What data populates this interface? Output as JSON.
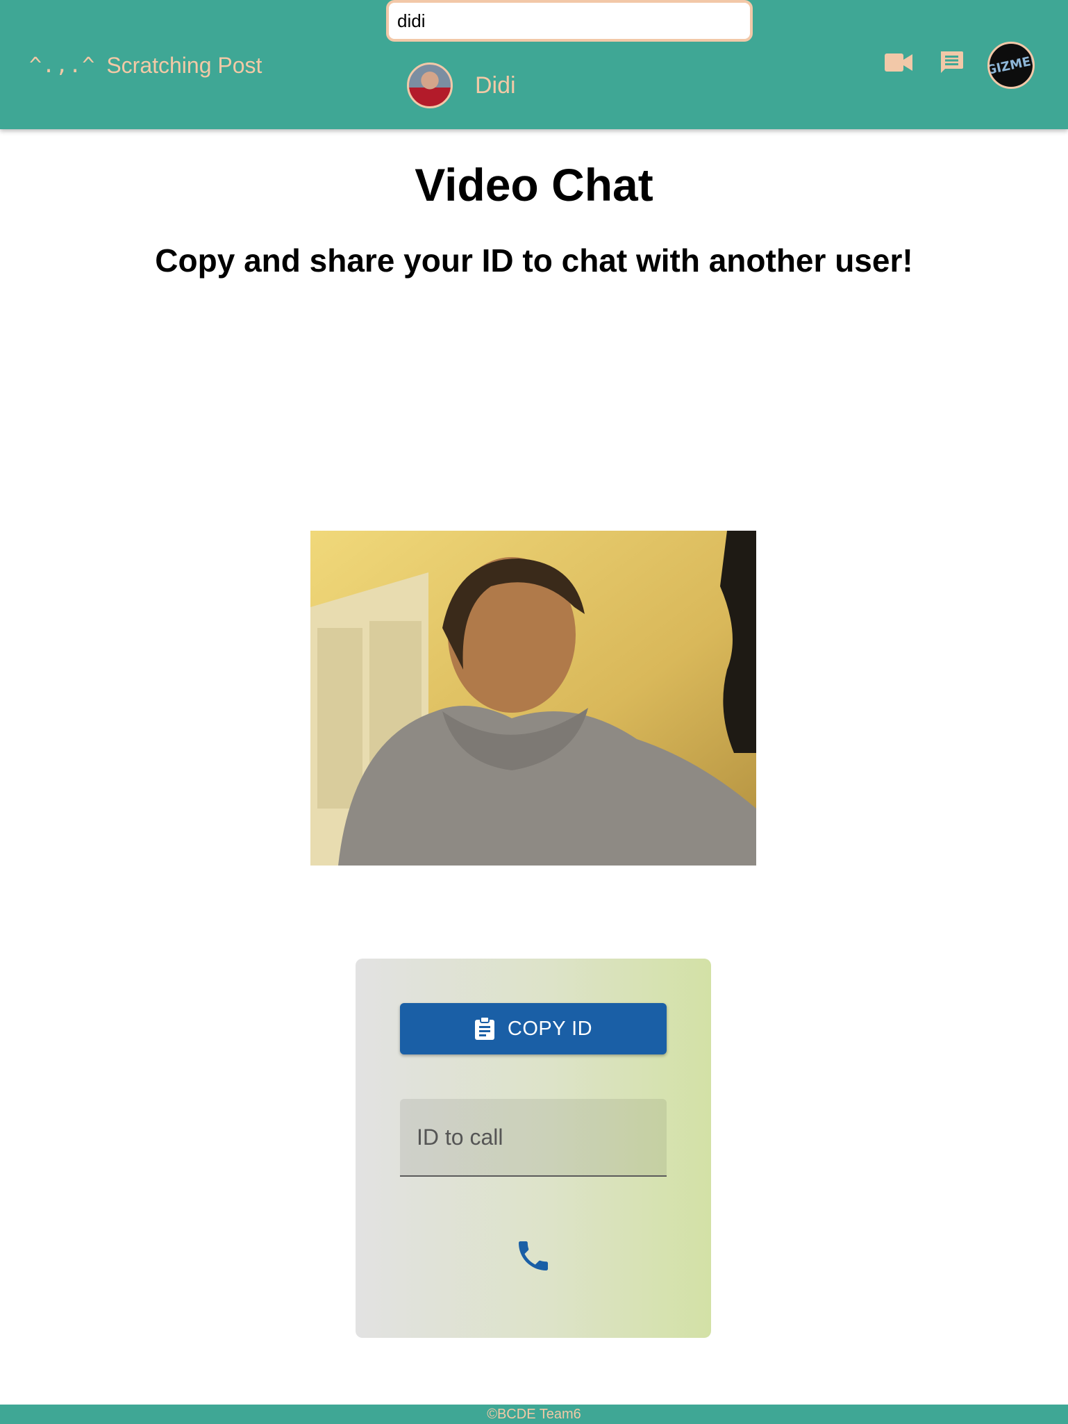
{
  "header": {
    "brand_logo": "^.,.^",
    "brand_name": "Scratching Post",
    "search_value": "didi",
    "search_result_name": "Didi",
    "profile_badge": "GIZMEI"
  },
  "main": {
    "title": "Video Chat",
    "subtitle": "Copy and share your ID to chat with another user!"
  },
  "panel": {
    "copy_label": "COPY ID",
    "id_placeholder": "ID to call"
  },
  "icons": {
    "video": "video-camera-icon",
    "chat": "chat-icon",
    "clipboard": "clipboard-icon",
    "phone": "phone-icon"
  },
  "colors": {
    "header_bg": "#3fa795",
    "accent_peach": "#f3c9a6",
    "button_blue": "#1a5fa6"
  },
  "footer": {
    "text": "©BCDE Team6"
  }
}
